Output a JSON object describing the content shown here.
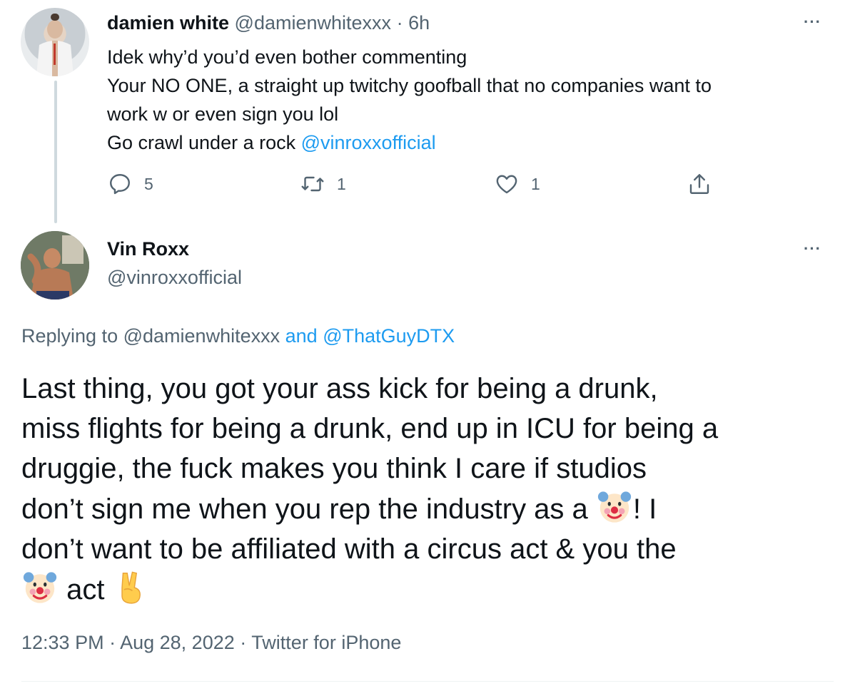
{
  "reply": {
    "name": "damien white",
    "handle": "@damienwhitexxx",
    "separator": "·",
    "time": "6h",
    "lines": [
      "Idek why’d you’d even bother commenting",
      "Your NO ONE, a straight up twitchy goofball that no companies want to",
      "work w or even sign you lol"
    ],
    "last_line_text": "Go crawl under a rock",
    "last_line_mention": "@vinroxxofficial",
    "actions": {
      "reply_count": "5",
      "retweet_count": "1",
      "like_count": "1"
    }
  },
  "main": {
    "name": "Vin Roxx",
    "handle": "@vinroxxofficial",
    "replying_prefix": "Replying to",
    "replying_to_1": "@damienwhitexxx",
    "replying_and": "and",
    "replying_to_2": "@ThatGuyDTX",
    "text_lines": [
      "Last thing, you got your ass kick for being a drunk,",
      "miss flights for being a drunk, end up in ICU for being a",
      "druggie, the fuck makes you think I care if studios"
    ],
    "line4_before": "don’t sign me when you rep the industry as a",
    "line4_after": "! I",
    "line5": "don’t want to be affiliated with a circus act & you the",
    "line6_after": "act",
    "emojis": [
      "clown-face",
      "victory-hand"
    ],
    "meta": {
      "time": "12:33 PM",
      "date": "Aug 28, 2022",
      "source": "Twitter for iPhone",
      "separator": "·"
    }
  },
  "colors": {
    "text": "#0f1419",
    "secondary": "#536471",
    "link": "#1d9bf0",
    "thread_line": "#cfd9de"
  }
}
